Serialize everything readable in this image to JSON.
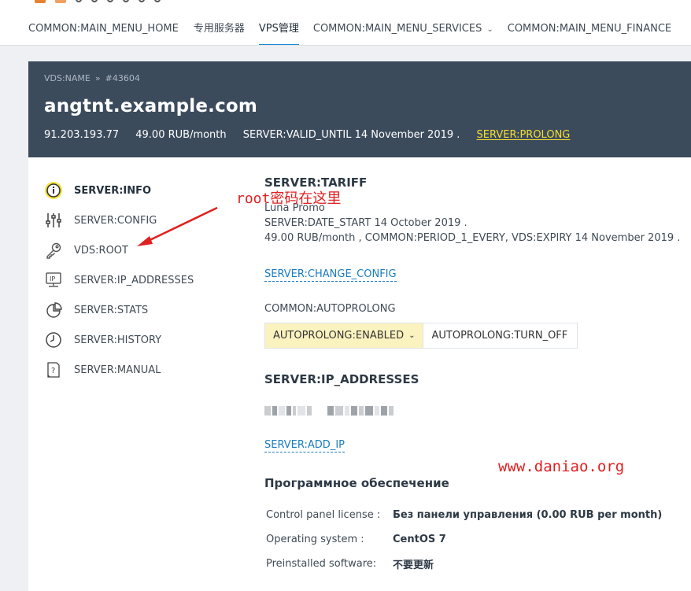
{
  "nav": {
    "items": [
      {
        "label": "COMMON:MAIN_MENU_HOME",
        "active": false
      },
      {
        "label": "专用服务器",
        "active": false
      },
      {
        "label": "VPS管理",
        "active": true
      },
      {
        "label": "COMMON:MAIN_MENU_SERVICES",
        "dropdown": true
      },
      {
        "label": "COMMON:MAIN_MENU_FINANCE"
      }
    ],
    "chevron": "⌄"
  },
  "hero": {
    "crumb_name": "VDS:NAME",
    "crumb_sep": "»",
    "crumb_id": "#43604",
    "hostname": "angtnt.example.com",
    "ip": "91.203.193.77",
    "price": "49.00 RUB/month",
    "valid_until": "SERVER:VALID_UNTIL 14 November 2019 .",
    "prolong": "SERVER:PROLONG"
  },
  "sidebar": {
    "items": [
      {
        "label": "SERVER:INFO",
        "icon": "info-icon",
        "active": true
      },
      {
        "label": "SERVER:CONFIG",
        "icon": "sliders-icon"
      },
      {
        "label": "VDS:ROOT",
        "icon": "key-icon"
      },
      {
        "label": "SERVER:IP_ADDRESSES",
        "icon": "ip-icon"
      },
      {
        "label": "SERVER:STATS",
        "icon": "pie-chart-icon"
      },
      {
        "label": "SERVER:HISTORY",
        "icon": "clock-icon"
      },
      {
        "label": "SERVER:MANUAL",
        "icon": "help-doc-icon"
      }
    ]
  },
  "annotation": {
    "prefix": "root",
    "text": "密码在这里",
    "color": "#e02020"
  },
  "tariff": {
    "heading": "SERVER:TARIFF",
    "plan": "Luna Promo",
    "date_start": "SERVER:DATE_START 14 October 2019 .",
    "period": "49.00 RUB/month , COMMON:PERIOD_1_EVERY, VDS:EXPIRY 14 November 2019 .",
    "change_config": "SERVER:CHANGE_CONFIG"
  },
  "autoprolong": {
    "label": "COMMON:AUTOPROLONG",
    "enabled": "AUTOPROLONG:ENABLED",
    "turn_off": "AUTOPROLONG:TURN_OFF"
  },
  "ip_section": {
    "heading": "SERVER:IP_ADDRESSES",
    "add_ip": "SERVER:ADD_IP"
  },
  "watermark": "www.daniao.org",
  "software": {
    "heading": "Программное обеспечение",
    "rows": [
      {
        "key": "Control panel license :",
        "value": "Без панели управления (0.00 RUB per month)"
      },
      {
        "key": "Operating system :",
        "value": "CentOS 7"
      },
      {
        "key": "Preinstalled software:",
        "value": "不要更新"
      }
    ]
  },
  "colors": {
    "hero_bg": "#3c4b5c",
    "accent": "#1a8ad8",
    "prolong": "#f6de2d",
    "enabled_bg": "#fbf3bf"
  }
}
